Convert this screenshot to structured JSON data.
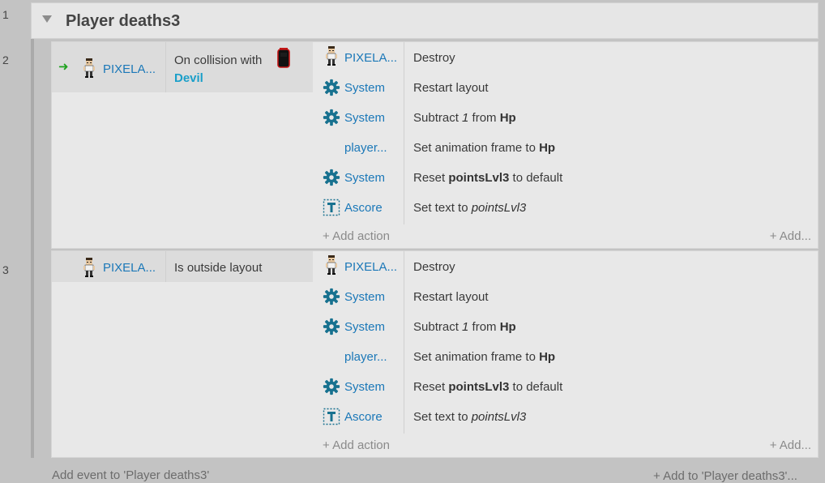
{
  "row_numbers": [
    "1",
    "2",
    "3"
  ],
  "group": {
    "title": "Player deaths3"
  },
  "events": [
    {
      "condition": {
        "object": "PIXELA...",
        "text": "On collision with",
        "param": "Devil"
      },
      "actions": [
        {
          "object": "PIXELA...",
          "icon": "pixel-player-icon",
          "text_plain": "Destroy"
        },
        {
          "object": "System",
          "icon": "gear-icon",
          "text_plain": "Restart layout"
        },
        {
          "object": "System",
          "icon": "gear-icon",
          "pre": "Subtract ",
          "val": "1",
          "mid": " from ",
          "bold": "Hp"
        },
        {
          "object": "player...",
          "icon": "",
          "pre": "Set animation frame to ",
          "bold": "Hp"
        },
        {
          "object": "System",
          "icon": "gear-icon",
          "pre": "Reset ",
          "bold": "pointsLvl3",
          "post": " to default"
        },
        {
          "object": "Ascore",
          "icon": "text-icon",
          "pre": "Set text to ",
          "ital": "pointsLvl3"
        }
      ],
      "add_action": "+ Add action",
      "add_more": "+ Add..."
    },
    {
      "condition": {
        "object": "PIXELA...",
        "text": "Is outside layout"
      },
      "actions": [
        {
          "object": "PIXELA...",
          "icon": "pixel-player-icon",
          "text_plain": "Destroy"
        },
        {
          "object": "System",
          "icon": "gear-icon",
          "text_plain": "Restart layout"
        },
        {
          "object": "System",
          "icon": "gear-icon",
          "pre": "Subtract ",
          "val": "1",
          "mid": " from ",
          "bold": "Hp"
        },
        {
          "object": "player...",
          "icon": "",
          "pre": "Set animation frame to ",
          "bold": "Hp"
        },
        {
          "object": "System",
          "icon": "gear-icon",
          "pre": "Reset ",
          "bold": "pointsLvl3",
          "post": " to default"
        },
        {
          "object": "Ascore",
          "icon": "text-icon",
          "pre": "Set text to ",
          "ital": "pointsLvl3"
        }
      ],
      "add_action": "+ Add action",
      "add_more": "+ Add..."
    }
  ],
  "footer": {
    "add_event": "Add event to 'Player deaths3'",
    "add_to": "+ Add to 'Player deaths3'..."
  },
  "colors": {
    "link": "#1b78b8",
    "param": "#1a9fc9",
    "trigger_arrow": "#1fa31f",
    "gear": "#17718f"
  }
}
